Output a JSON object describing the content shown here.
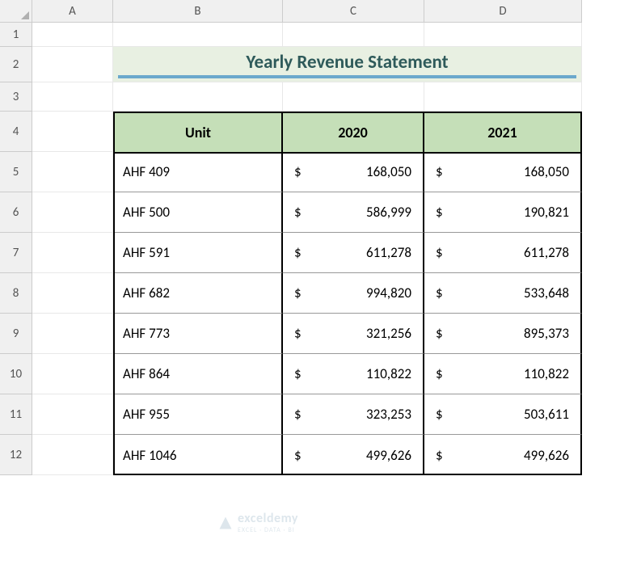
{
  "columns": [
    "A",
    "B",
    "C",
    "D"
  ],
  "rows": [
    "1",
    "2",
    "3",
    "4",
    "5",
    "6",
    "7",
    "8",
    "9",
    "10",
    "11",
    "12"
  ],
  "title": "Yearly Revenue Statement",
  "headers": {
    "unit": "Unit",
    "y2020": "2020",
    "y2021": "2021"
  },
  "currency": "$",
  "data": [
    {
      "unit": "AHF 409",
      "y2020": "168,050",
      "y2021": "168,050"
    },
    {
      "unit": "AHF 500",
      "y2020": "586,999",
      "y2021": "190,821"
    },
    {
      "unit": "AHF 591",
      "y2020": "611,278",
      "y2021": "611,278"
    },
    {
      "unit": "AHF 682",
      "y2020": "994,820",
      "y2021": "533,648"
    },
    {
      "unit": "AHF 773",
      "y2020": "321,256",
      "y2021": "895,373"
    },
    {
      "unit": "AHF 864",
      "y2020": "110,822",
      "y2021": "110,822"
    },
    {
      "unit": "AHF 955",
      "y2020": "323,253",
      "y2021": "503,611"
    },
    {
      "unit": "AHF 1046",
      "y2020": "499,626",
      "y2021": "499,626"
    }
  ],
  "watermark": {
    "brand": "exceldemy",
    "tag": "EXCEL · DATA · BI"
  }
}
